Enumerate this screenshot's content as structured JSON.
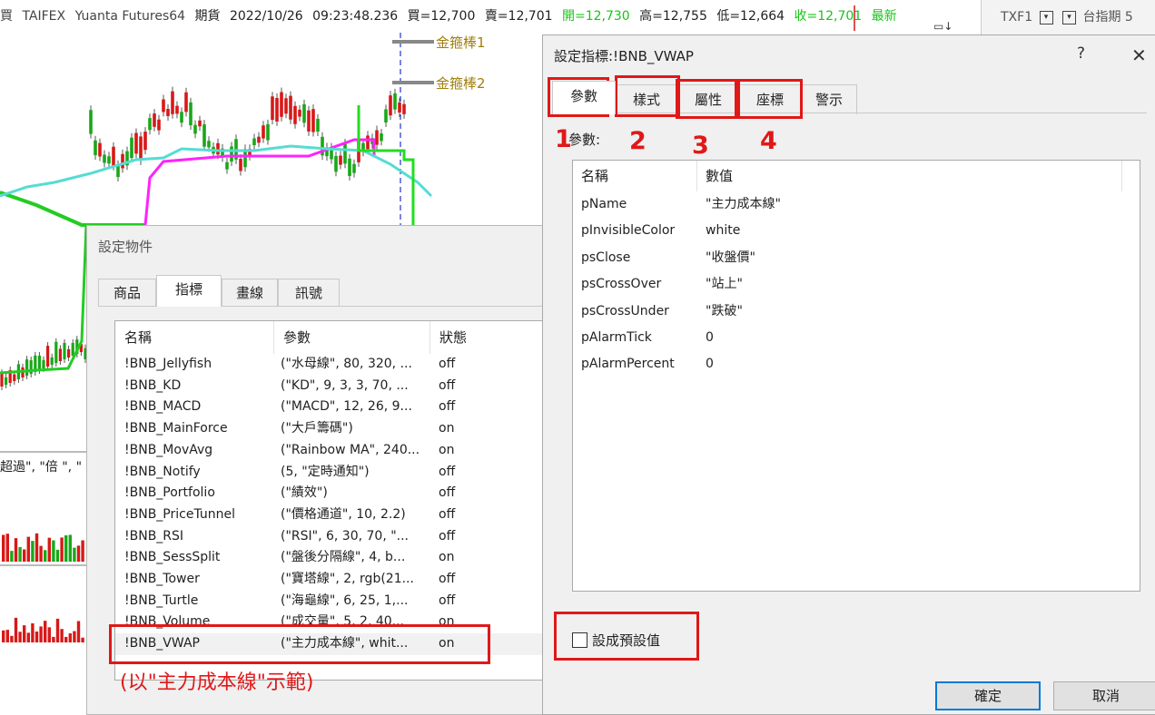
{
  "status_bar": {
    "items": [
      {
        "text": "買",
        "color": "gray"
      },
      {
        "text": "TAIFEX",
        "color": "gray"
      },
      {
        "text": "Yuanta Futures64",
        "color": "gray"
      },
      {
        "text": "期貨",
        "color": "black"
      },
      {
        "text": "2022/10/26",
        "color": "black"
      },
      {
        "text": "09:23:48.236",
        "color": "black"
      },
      {
        "text": "買=12,700",
        "color": "black"
      },
      {
        "text": "賣=12,701",
        "color": "black"
      },
      {
        "text": "開=12,730",
        "color": "green"
      },
      {
        "text": "高=12,755",
        "color": "black"
      },
      {
        "text": "低=12,664",
        "color": "black"
      },
      {
        "text": "收=12,701",
        "color": "green"
      },
      {
        "text": "最新",
        "color": "green"
      }
    ]
  },
  "right_strip": {
    "symbol": "TXF1",
    "label": "台指期 5"
  },
  "chart": {
    "labels": [
      "金箍棒1",
      "金箍棒2"
    ],
    "lower_panel_text": "超過\", \"倍 \", \""
  },
  "object_dialog": {
    "title": "設定物件",
    "tabs": [
      "商品",
      "指標",
      "畫線",
      "訊號"
    ],
    "active_tab": "指標",
    "columns": [
      "名稱",
      "參數",
      "狀態"
    ],
    "rows": [
      {
        "name": "!BNB_Jellyfish",
        "params": "(\"水母線\", 80, 320, ...",
        "status": "off"
      },
      {
        "name": "!BNB_KD",
        "params": "(\"KD\", 9, 3, 3, 70, ...",
        "status": "off"
      },
      {
        "name": "!BNB_MACD",
        "params": "(\"MACD\", 12, 26, 9...",
        "status": "off"
      },
      {
        "name": "!BNB_MainForce",
        "params": "(\"大戶籌碼\")",
        "status": "on"
      },
      {
        "name": "!BNB_MovAvg",
        "params": "(\"Rainbow MA\", 240...",
        "status": "on"
      },
      {
        "name": "!BNB_Notify",
        "params": "(5, \"定時通知\")",
        "status": "off"
      },
      {
        "name": "!BNB_Portfolio",
        "params": "(\"績效\")",
        "status": "off"
      },
      {
        "name": "!BNB_PriceTunnel",
        "params": "(\"價格通道\", 10, 2.2)",
        "status": "off"
      },
      {
        "name": "!BNB_RSI",
        "params": "(\"RSI\", 6, 30, 70, \"...",
        "status": "off"
      },
      {
        "name": "!BNB_SessSplit",
        "params": "(\"盤後分隔線\", 4, b...",
        "status": "on"
      },
      {
        "name": "!BNB_Tower",
        "params": "(\"寶塔線\", 2, rgb(21...",
        "status": "off"
      },
      {
        "name": "!BNB_Turtle",
        "params": "(\"海龜線\", 6, 25, 1,...",
        "status": "off"
      },
      {
        "name": "!BNB_Volume",
        "params": "(\"成交量\", 5, 2, 40...",
        "status": "on"
      },
      {
        "name": "!BNB_VWAP",
        "params": "(\"主力成本線\", whit...",
        "status": "on"
      }
    ],
    "selected_row": "!BNB_VWAP",
    "example_note": "(以\"主力成本線\"示範)"
  },
  "indicator_dialog": {
    "title": "設定指標:!BNB_VWAP",
    "help": "?",
    "close": "✕",
    "tabs": [
      "參數",
      "樣式",
      "屬性",
      "座標",
      "警示"
    ],
    "active_tab": "參數",
    "params_label": "參數:",
    "columns": [
      "名稱",
      "數值"
    ],
    "params": [
      {
        "name": "pName",
        "value": "\"主力成本線\""
      },
      {
        "name": "pInvisibleColor",
        "value": "white"
      },
      {
        "name": "psClose",
        "value": "\"收盤價\""
      },
      {
        "name": "psCrossOver",
        "value": "\"站上\""
      },
      {
        "name": "psCrossUnder",
        "value": "\"跌破\""
      },
      {
        "name": "pAlarmTick",
        "value": "0"
      },
      {
        "name": "pAlarmPercent",
        "value": "0"
      }
    ],
    "default_checkbox_label": "設成預設值",
    "ok_label": "確定",
    "cancel_label": "取消"
  },
  "annotations": {
    "numbers": [
      "1",
      "2",
      "3",
      "4"
    ],
    "color": "#e01818"
  },
  "colors": {
    "green_up": "#18c418",
    "red_down": "#d81818",
    "accent_blue": "#0078d7",
    "annotation_red": "#e01818"
  }
}
